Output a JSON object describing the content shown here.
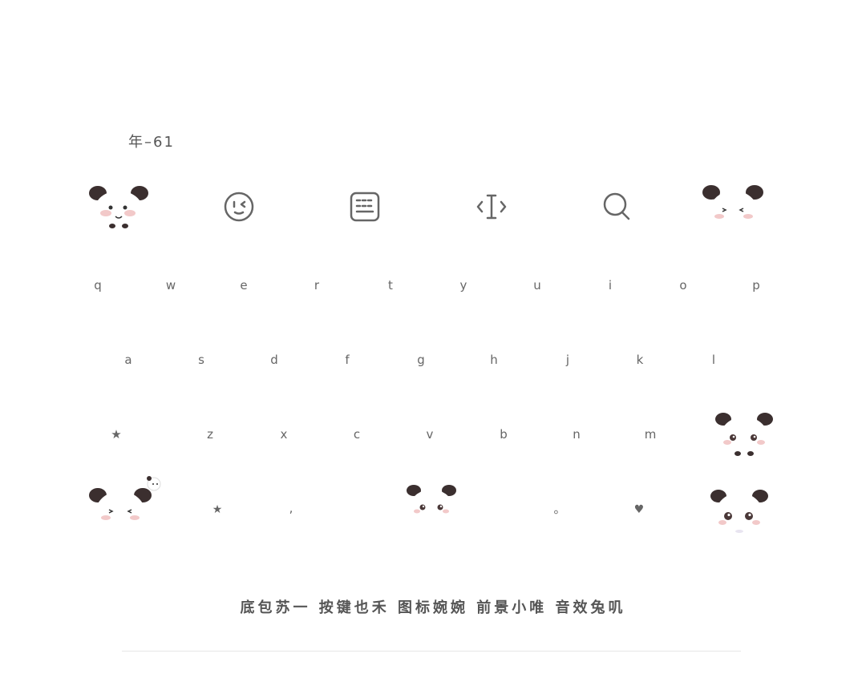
{
  "header": {
    "label": "年–61"
  },
  "toolbar": {
    "icons": [
      "emoji-icon",
      "keyboard-icon",
      "cursor-icon",
      "search-icon"
    ]
  },
  "keyboard": {
    "row1": [
      "q",
      "w",
      "e",
      "r",
      "t",
      "y",
      "u",
      "i",
      "o",
      "p"
    ],
    "row2": [
      "a",
      "s",
      "d",
      "f",
      "g",
      "h",
      "j",
      "k",
      "l"
    ],
    "row3": [
      "★",
      "z",
      "x",
      "c",
      "v",
      "b",
      "n",
      "m"
    ],
    "row4": {
      "star": "★",
      "comma": ",",
      "period": "。",
      "heart": "♥"
    }
  },
  "credits": "底包苏一  按键也禾  图标婉婉   前景小唯  音效兔叽",
  "colors": {
    "ink": "#555555",
    "panda_ear": "#3b2f2f",
    "blush": "#f2c9c9"
  }
}
